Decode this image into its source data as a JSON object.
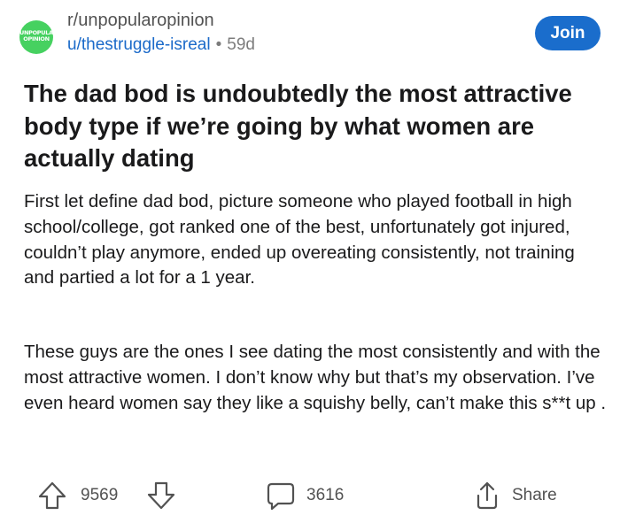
{
  "post": {
    "subreddit": "r/unpopularopinion",
    "subreddit_icon_text": [
      "UNPOPULAR",
      "OPINION"
    ],
    "author": "u/thestruggle-isreal",
    "separator": "•",
    "age": "59d",
    "join_label": "Join",
    "title": "The dad bod is undoubtedly the most attractive body type if we’re going by what women are actually dating",
    "body": [
      "First let define dad bod, picture someone who played football in high school/college, got ranked one of the best, unfortunately got injured, couldn’t play anymore, ended up overeating consistently, not training and partied a lot for a 1 year.",
      "These guys are the ones I see dating the most consistently and with the most attractive women. I don’t know why but that’s my observation. I’ve even heard women say they like a squishy belly, can’t make this s**t up ."
    ]
  },
  "actions": {
    "upvote_count": "9569",
    "comment_count": "3616",
    "share_label": "Share"
  },
  "colors": {
    "accent": "#1a6dcc",
    "username": "#1b6ac9",
    "subreddit_icon": "#46d160",
    "muted": "#7c7c7c"
  },
  "icons": [
    "upvote-icon",
    "downvote-icon",
    "comment-icon",
    "share-icon"
  ]
}
